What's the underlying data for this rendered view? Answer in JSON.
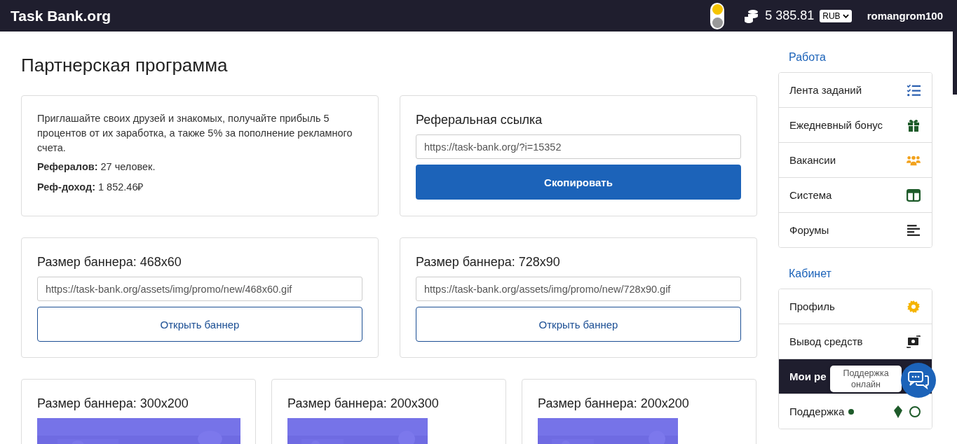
{
  "header": {
    "logo": "Task Bank.org",
    "dark_mode": false,
    "balance": "5 385.81",
    "currency": "RUB",
    "username": "romangrom100"
  },
  "page_title": "Партнерская программа",
  "info_card": {
    "text": "Приглашайте своих друзей и знакомых, получайте прибыль 5 процентов от их заработка, а также 5% за пополнение рекламного счета.",
    "stats": [
      {
        "label": "Рефералов:",
        "value": "27 человек."
      },
      {
        "label": "Реф-доход:",
        "value": "1 852.46₽"
      }
    ]
  },
  "ref_link_card": {
    "title": "Реферальная ссылка",
    "value": "https://task-bank.org/?i=15352",
    "button": "Скопировать"
  },
  "banner_cards": [
    {
      "title": "Размер баннера: 468x60",
      "value": "https://task-bank.org/assets/img/promo/new/468x60.gif",
      "button": "Открыть баннер"
    },
    {
      "title": "Размер баннера: 728x90",
      "value": "https://task-bank.org/assets/img/promo/new/728x90.gif",
      "button": "Открыть баннер"
    }
  ],
  "banner_previews": [
    {
      "title": "Размер баннера: 300x200",
      "kind": "wide"
    },
    {
      "title": "Размер баннера: 200x300",
      "kind": "narrow"
    },
    {
      "title": "Размер баннера: 200x200",
      "kind": "narrow"
    }
  ],
  "sidebar": [
    {
      "heading": "Работа",
      "items": [
        {
          "label": "Лента заданий",
          "kind": "tasks",
          "selected": false,
          "online": false
        },
        {
          "label": "Ежедневный бонус",
          "kind": "gift",
          "selected": false,
          "online": false
        },
        {
          "label": "Вакансии",
          "kind": "users",
          "selected": false,
          "online": false
        },
        {
          "label": "Система",
          "kind": "columns",
          "selected": false,
          "online": false
        },
        {
          "label": "Форумы",
          "kind": "lines",
          "selected": false,
          "online": false
        }
      ]
    },
    {
      "heading": "Кабинет",
      "items": [
        {
          "label": "Профиль",
          "kind": "gear",
          "selected": false,
          "online": false
        },
        {
          "label": "Вывод средств",
          "kind": "money",
          "selected": false,
          "online": false
        },
        {
          "label": "Мои ре",
          "kind": "plain",
          "selected": true,
          "online": false
        },
        {
          "label": "Поддержка",
          "kind": "support",
          "selected": false,
          "online": true
        }
      ]
    }
  ],
  "support_chat": {
    "tooltip": "Поддержка онлайн"
  }
}
